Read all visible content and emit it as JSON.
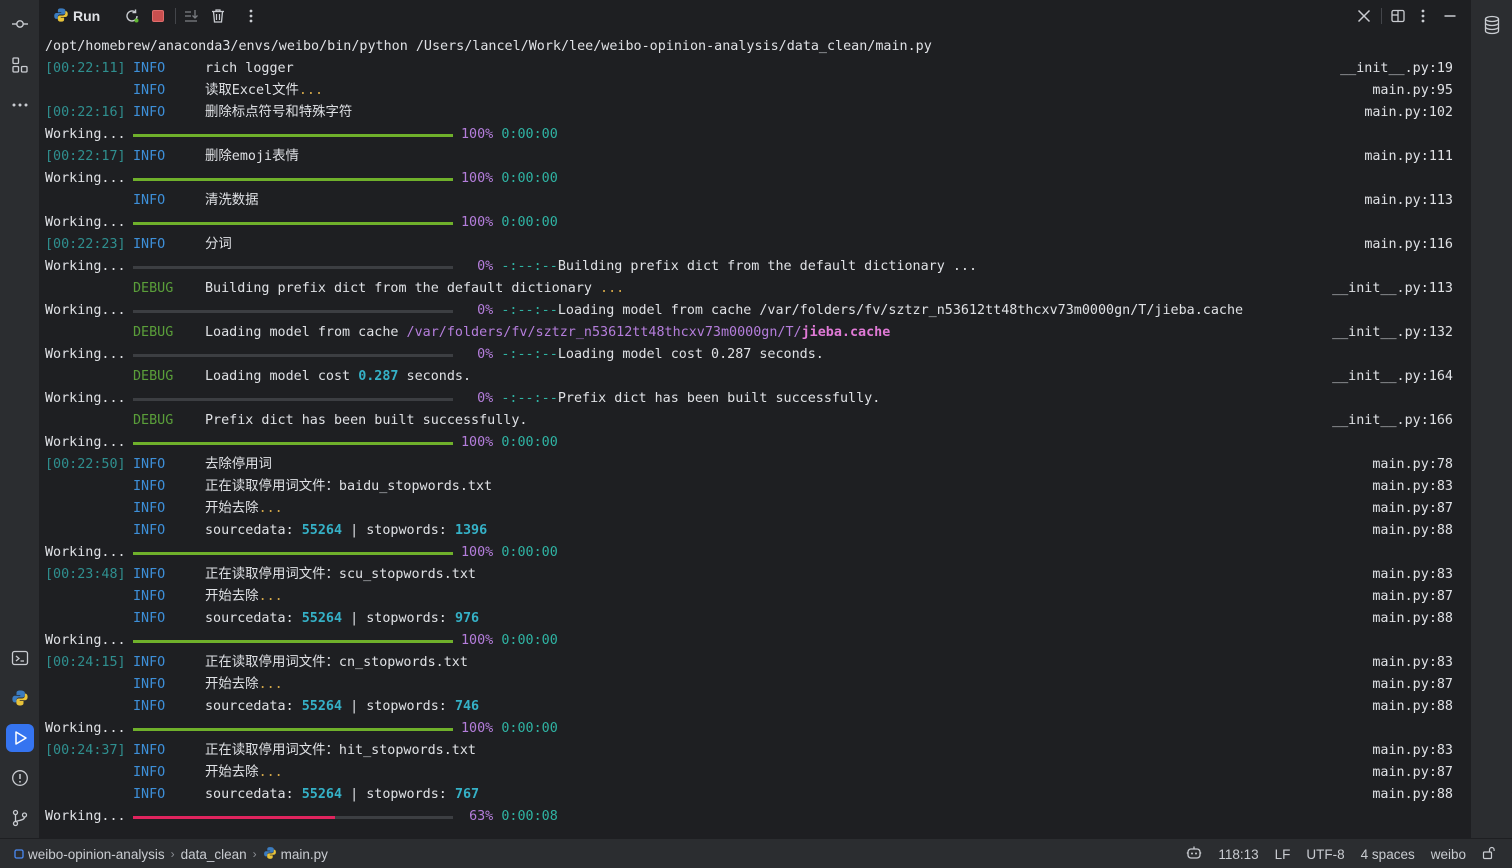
{
  "toolwindow": {
    "title": "Run"
  },
  "console": {
    "command": "/opt/homebrew/anaconda3/envs/weibo/bin/python /Users/lancel/Work/lee/weibo-opinion-analysis/data_clean/main.py",
    "lines": [
      {
        "ts": "[00:22:11]",
        "level": "INFO",
        "msg": "rich logger",
        "src": "__init__.py",
        "lineno": "19"
      },
      {
        "ts": "",
        "level": "INFO",
        "msg": "读取Excel文件",
        "dots": "...",
        "src": "main.py",
        "lineno": "95"
      },
      {
        "ts": "[00:22:16]",
        "level": "INFO",
        "msg": "删除标点符号和特殊字符",
        "src": "main.py",
        "lineno": "102"
      },
      {
        "label": "Working...",
        "progress": 1.0,
        "pct": "100%",
        "eta": "0:00:00"
      },
      {
        "ts": "[00:22:17]",
        "level": "INFO",
        "msg": "删除emoji表情",
        "src": "main.py",
        "lineno": "111"
      },
      {
        "label": "Working...",
        "progress": 1.0,
        "pct": "100%",
        "eta": "0:00:00"
      },
      {
        "ts": "",
        "level": "INFO",
        "msg": "清洗数据",
        "src": "main.py",
        "lineno": "113"
      },
      {
        "label": "Working...",
        "progress": 1.0,
        "pct": "100%",
        "eta": "0:00:00"
      },
      {
        "ts": "[00:22:23]",
        "level": "INFO",
        "msg": "分词",
        "src": "main.py",
        "lineno": "116"
      },
      {
        "label": "Working...",
        "progress": 0.0,
        "pct": "0%",
        "eta": "-:--:--",
        "tail": "Building prefix dict from the default dictionary ..."
      },
      {
        "ts": "",
        "level": "DEBUG",
        "msg": "Building prefix dict from the default dictionary",
        "dots": " ...",
        "src": "__init__.py",
        "lineno": "113"
      },
      {
        "label": "Working...",
        "progress": 0.0,
        "pct": "0%",
        "eta": "-:--:--",
        "tail": "Loading model from cache /var/folders/fv/sztzr_n53612tt48thcxv73m0000gn/T/jieba.cache"
      },
      {
        "ts": "",
        "level": "DEBUG",
        "msg": "Loading model from cache ",
        "path_a": "/var/folders/fv/sztzr_n53612tt48thcxv73m0000gn/T/",
        "path_b": "jieba.cache",
        "src": "__init__.py",
        "lineno": "132"
      },
      {
        "label": "Working...",
        "progress": 0.0,
        "pct": "0%",
        "eta": "-:--:--",
        "tail": "Loading model cost 0.287 seconds."
      },
      {
        "ts": "",
        "level": "DEBUG",
        "msg": "Loading model cost ",
        "num": "0.287",
        "msg2": " seconds.",
        "src": "__init__.py",
        "lineno": "164"
      },
      {
        "label": "Working...",
        "progress": 0.0,
        "pct": "0%",
        "eta": "-:--:--",
        "tail": "Prefix dict has been built successfully."
      },
      {
        "ts": "",
        "level": "DEBUG",
        "msg": "Prefix dict has been built successfully.",
        "src": "__init__.py",
        "lineno": "166"
      },
      {
        "label": "Working...",
        "progress": 1.0,
        "pct": "100%",
        "eta": "0:00:00"
      },
      {
        "ts": "[00:22:50]",
        "level": "INFO",
        "msg": "去除停用词",
        "src": "main.py",
        "lineno": "78"
      },
      {
        "ts": "",
        "level": "INFO",
        "msg": "正在读取停用词文件：baidu_stopwords.txt",
        "src": "main.py",
        "lineno": "83"
      },
      {
        "ts": "",
        "level": "INFO",
        "msg": "开始去除",
        "dots": "...",
        "src": "main.py",
        "lineno": "87"
      },
      {
        "ts": "",
        "level": "INFO",
        "msg": "sourcedata: ",
        "num": "55264",
        "msg2": " | stopwords: ",
        "num2": "1396",
        "src": "main.py",
        "lineno": "88"
      },
      {
        "label": "Working...",
        "progress": 1.0,
        "pct": "100%",
        "eta": "0:00:00"
      },
      {
        "ts": "[00:23:48]",
        "level": "INFO",
        "msg": "正在读取停用词文件：scu_stopwords.txt",
        "src": "main.py",
        "lineno": "83"
      },
      {
        "ts": "",
        "level": "INFO",
        "msg": "开始去除",
        "dots": "...",
        "src": "main.py",
        "lineno": "87"
      },
      {
        "ts": "",
        "level": "INFO",
        "msg": "sourcedata: ",
        "num": "55264",
        "msg2": " | stopwords: ",
        "num2": "976",
        "src": "main.py",
        "lineno": "88"
      },
      {
        "label": "Working...",
        "progress": 1.0,
        "pct": "100%",
        "eta": "0:00:00"
      },
      {
        "ts": "[00:24:15]",
        "level": "INFO",
        "msg": "正在读取停用词文件：cn_stopwords.txt",
        "src": "main.py",
        "lineno": "83"
      },
      {
        "ts": "",
        "level": "INFO",
        "msg": "开始去除",
        "dots": "...",
        "src": "main.py",
        "lineno": "87"
      },
      {
        "ts": "",
        "level": "INFO",
        "msg": "sourcedata: ",
        "num": "55264",
        "msg2": " | stopwords: ",
        "num2": "746",
        "src": "main.py",
        "lineno": "88"
      },
      {
        "label": "Working...",
        "progress": 1.0,
        "pct": "100%",
        "eta": "0:00:00"
      },
      {
        "ts": "[00:24:37]",
        "level": "INFO",
        "msg": "正在读取停用词文件：hit_stopwords.txt",
        "src": "main.py",
        "lineno": "83"
      },
      {
        "ts": "",
        "level": "INFO",
        "msg": "开始去除",
        "dots": "...",
        "src": "main.py",
        "lineno": "87"
      },
      {
        "ts": "",
        "level": "INFO",
        "msg": "sourcedata: ",
        "num": "55264",
        "msg2": " | stopwords: ",
        "num2": "767",
        "src": "main.py",
        "lineno": "88"
      },
      {
        "label": "Working...",
        "progress": 0.63,
        "pct": "63%",
        "eta": "0:00:08",
        "active": true
      }
    ]
  },
  "statusbar": {
    "project": "weibo-opinion-analysis",
    "folder": "data_clean",
    "file": "main.py",
    "position": "118:13",
    "line_ending": "LF",
    "encoding": "UTF-8",
    "indent": "4 spaces",
    "interpreter": "weibo"
  },
  "colors": {
    "background": "#1e1f22",
    "info": "#3d8fd9",
    "debug": "#5a9e3a",
    "progress_done": "#6fb02b",
    "progress_active": "#e0245e",
    "accent": "#3574f0"
  },
  "icons": {
    "left": [
      "commit-icon",
      "structure-icon",
      "more-icon",
      "terminal-icon",
      "python-console-icon",
      "run-icon",
      "problems-icon",
      "git-icon"
    ],
    "toolbar": [
      "rerun-icon",
      "stop-icon",
      "scroll-to-end-icon",
      "clear-icon",
      "options-icon",
      "close-icon",
      "layout-icon",
      "more-icon",
      "minimize-icon"
    ],
    "right": [
      "database-icon"
    ]
  }
}
